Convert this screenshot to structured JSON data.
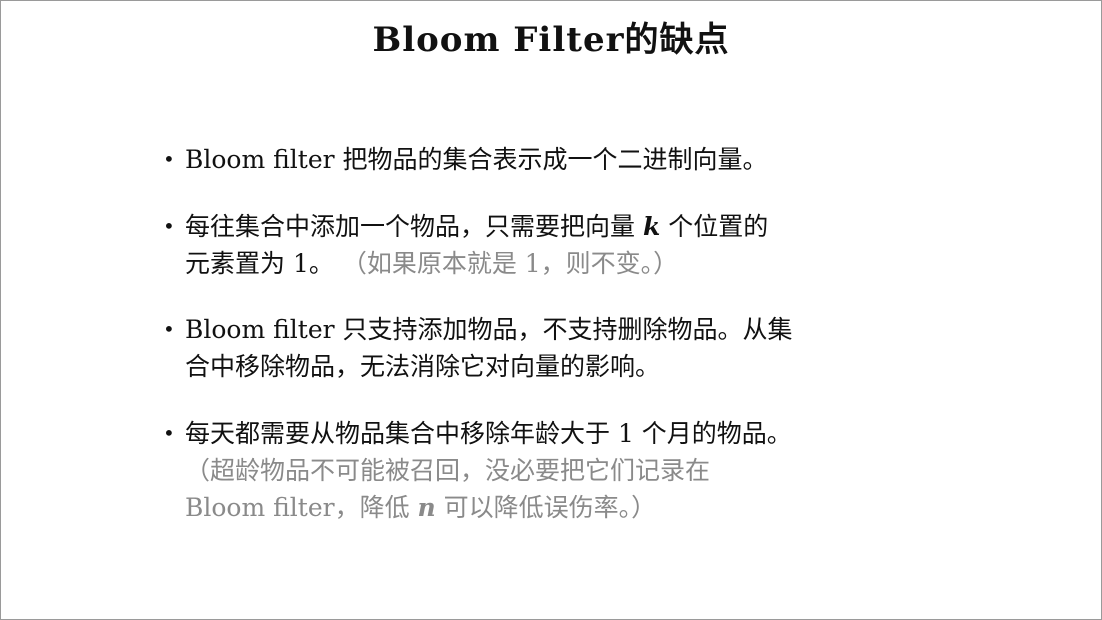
{
  "slide": {
    "title": "Bloom Filter的缺点",
    "bullet_symbol": "•",
    "bullets": [
      {
        "text": "Bloom filter 把物品的集合表示成一个二进制向量。"
      },
      {
        "text_before": "每往集合中添加一个物品，只需要把向量 ",
        "var": "k",
        "text_after": " 个位置的",
        "line2": "元素置为 1。",
        "note": "（如果原本就是 1，则不变。）"
      },
      {
        "line1": "Bloom filter 只支持添加物品，不支持删除物品。从集",
        "line2": "合中移除物品，无法消除它对向量的影响。"
      },
      {
        "line1": "每天都需要从物品集合中移除年龄大于 1 个月的物品。",
        "note_line1": "（超龄物品不可能被召回，没必要把它们记录在",
        "note_line2_before": "Bloom filter，降低 ",
        "note_var": "n",
        "note_line2_after": " 可以降低误伤率。）"
      }
    ]
  }
}
